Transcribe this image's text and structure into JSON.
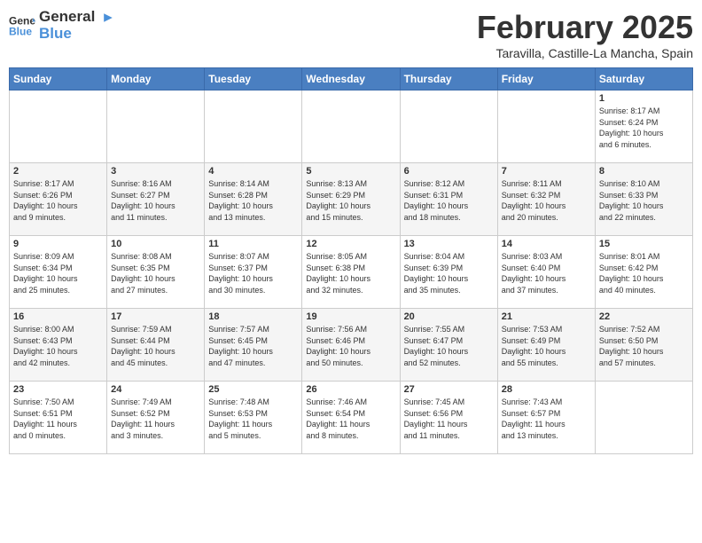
{
  "header": {
    "logo_line1": "General",
    "logo_line2": "Blue",
    "title": "February 2025",
    "subtitle": "Taravilla, Castille-La Mancha, Spain"
  },
  "weekdays": [
    "Sunday",
    "Monday",
    "Tuesday",
    "Wednesday",
    "Thursday",
    "Friday",
    "Saturday"
  ],
  "weeks": [
    [
      {
        "day": "",
        "info": ""
      },
      {
        "day": "",
        "info": ""
      },
      {
        "day": "",
        "info": ""
      },
      {
        "day": "",
        "info": ""
      },
      {
        "day": "",
        "info": ""
      },
      {
        "day": "",
        "info": ""
      },
      {
        "day": "1",
        "info": "Sunrise: 8:17 AM\nSunset: 6:24 PM\nDaylight: 10 hours\nand 6 minutes."
      }
    ],
    [
      {
        "day": "2",
        "info": "Sunrise: 8:17 AM\nSunset: 6:26 PM\nDaylight: 10 hours\nand 9 minutes."
      },
      {
        "day": "3",
        "info": "Sunrise: 8:16 AM\nSunset: 6:27 PM\nDaylight: 10 hours\nand 11 minutes."
      },
      {
        "day": "4",
        "info": "Sunrise: 8:14 AM\nSunset: 6:28 PM\nDaylight: 10 hours\nand 13 minutes."
      },
      {
        "day": "5",
        "info": "Sunrise: 8:13 AM\nSunset: 6:29 PM\nDaylight: 10 hours\nand 15 minutes."
      },
      {
        "day": "6",
        "info": "Sunrise: 8:12 AM\nSunset: 6:31 PM\nDaylight: 10 hours\nand 18 minutes."
      },
      {
        "day": "7",
        "info": "Sunrise: 8:11 AM\nSunset: 6:32 PM\nDaylight: 10 hours\nand 20 minutes."
      },
      {
        "day": "8",
        "info": "Sunrise: 8:10 AM\nSunset: 6:33 PM\nDaylight: 10 hours\nand 22 minutes."
      }
    ],
    [
      {
        "day": "9",
        "info": "Sunrise: 8:09 AM\nSunset: 6:34 PM\nDaylight: 10 hours\nand 25 minutes."
      },
      {
        "day": "10",
        "info": "Sunrise: 8:08 AM\nSunset: 6:35 PM\nDaylight: 10 hours\nand 27 minutes."
      },
      {
        "day": "11",
        "info": "Sunrise: 8:07 AM\nSunset: 6:37 PM\nDaylight: 10 hours\nand 30 minutes."
      },
      {
        "day": "12",
        "info": "Sunrise: 8:05 AM\nSunset: 6:38 PM\nDaylight: 10 hours\nand 32 minutes."
      },
      {
        "day": "13",
        "info": "Sunrise: 8:04 AM\nSunset: 6:39 PM\nDaylight: 10 hours\nand 35 minutes."
      },
      {
        "day": "14",
        "info": "Sunrise: 8:03 AM\nSunset: 6:40 PM\nDaylight: 10 hours\nand 37 minutes."
      },
      {
        "day": "15",
        "info": "Sunrise: 8:01 AM\nSunset: 6:42 PM\nDaylight: 10 hours\nand 40 minutes."
      }
    ],
    [
      {
        "day": "16",
        "info": "Sunrise: 8:00 AM\nSunset: 6:43 PM\nDaylight: 10 hours\nand 42 minutes."
      },
      {
        "day": "17",
        "info": "Sunrise: 7:59 AM\nSunset: 6:44 PM\nDaylight: 10 hours\nand 45 minutes."
      },
      {
        "day": "18",
        "info": "Sunrise: 7:57 AM\nSunset: 6:45 PM\nDaylight: 10 hours\nand 47 minutes."
      },
      {
        "day": "19",
        "info": "Sunrise: 7:56 AM\nSunset: 6:46 PM\nDaylight: 10 hours\nand 50 minutes."
      },
      {
        "day": "20",
        "info": "Sunrise: 7:55 AM\nSunset: 6:47 PM\nDaylight: 10 hours\nand 52 minutes."
      },
      {
        "day": "21",
        "info": "Sunrise: 7:53 AM\nSunset: 6:49 PM\nDaylight: 10 hours\nand 55 minutes."
      },
      {
        "day": "22",
        "info": "Sunrise: 7:52 AM\nSunset: 6:50 PM\nDaylight: 10 hours\nand 57 minutes."
      }
    ],
    [
      {
        "day": "23",
        "info": "Sunrise: 7:50 AM\nSunset: 6:51 PM\nDaylight: 11 hours\nand 0 minutes."
      },
      {
        "day": "24",
        "info": "Sunrise: 7:49 AM\nSunset: 6:52 PM\nDaylight: 11 hours\nand 3 minutes."
      },
      {
        "day": "25",
        "info": "Sunrise: 7:48 AM\nSunset: 6:53 PM\nDaylight: 11 hours\nand 5 minutes."
      },
      {
        "day": "26",
        "info": "Sunrise: 7:46 AM\nSunset: 6:54 PM\nDaylight: 11 hours\nand 8 minutes."
      },
      {
        "day": "27",
        "info": "Sunrise: 7:45 AM\nSunset: 6:56 PM\nDaylight: 11 hours\nand 11 minutes."
      },
      {
        "day": "28",
        "info": "Sunrise: 7:43 AM\nSunset: 6:57 PM\nDaylight: 11 hours\nand 13 minutes."
      },
      {
        "day": "",
        "info": ""
      }
    ]
  ]
}
